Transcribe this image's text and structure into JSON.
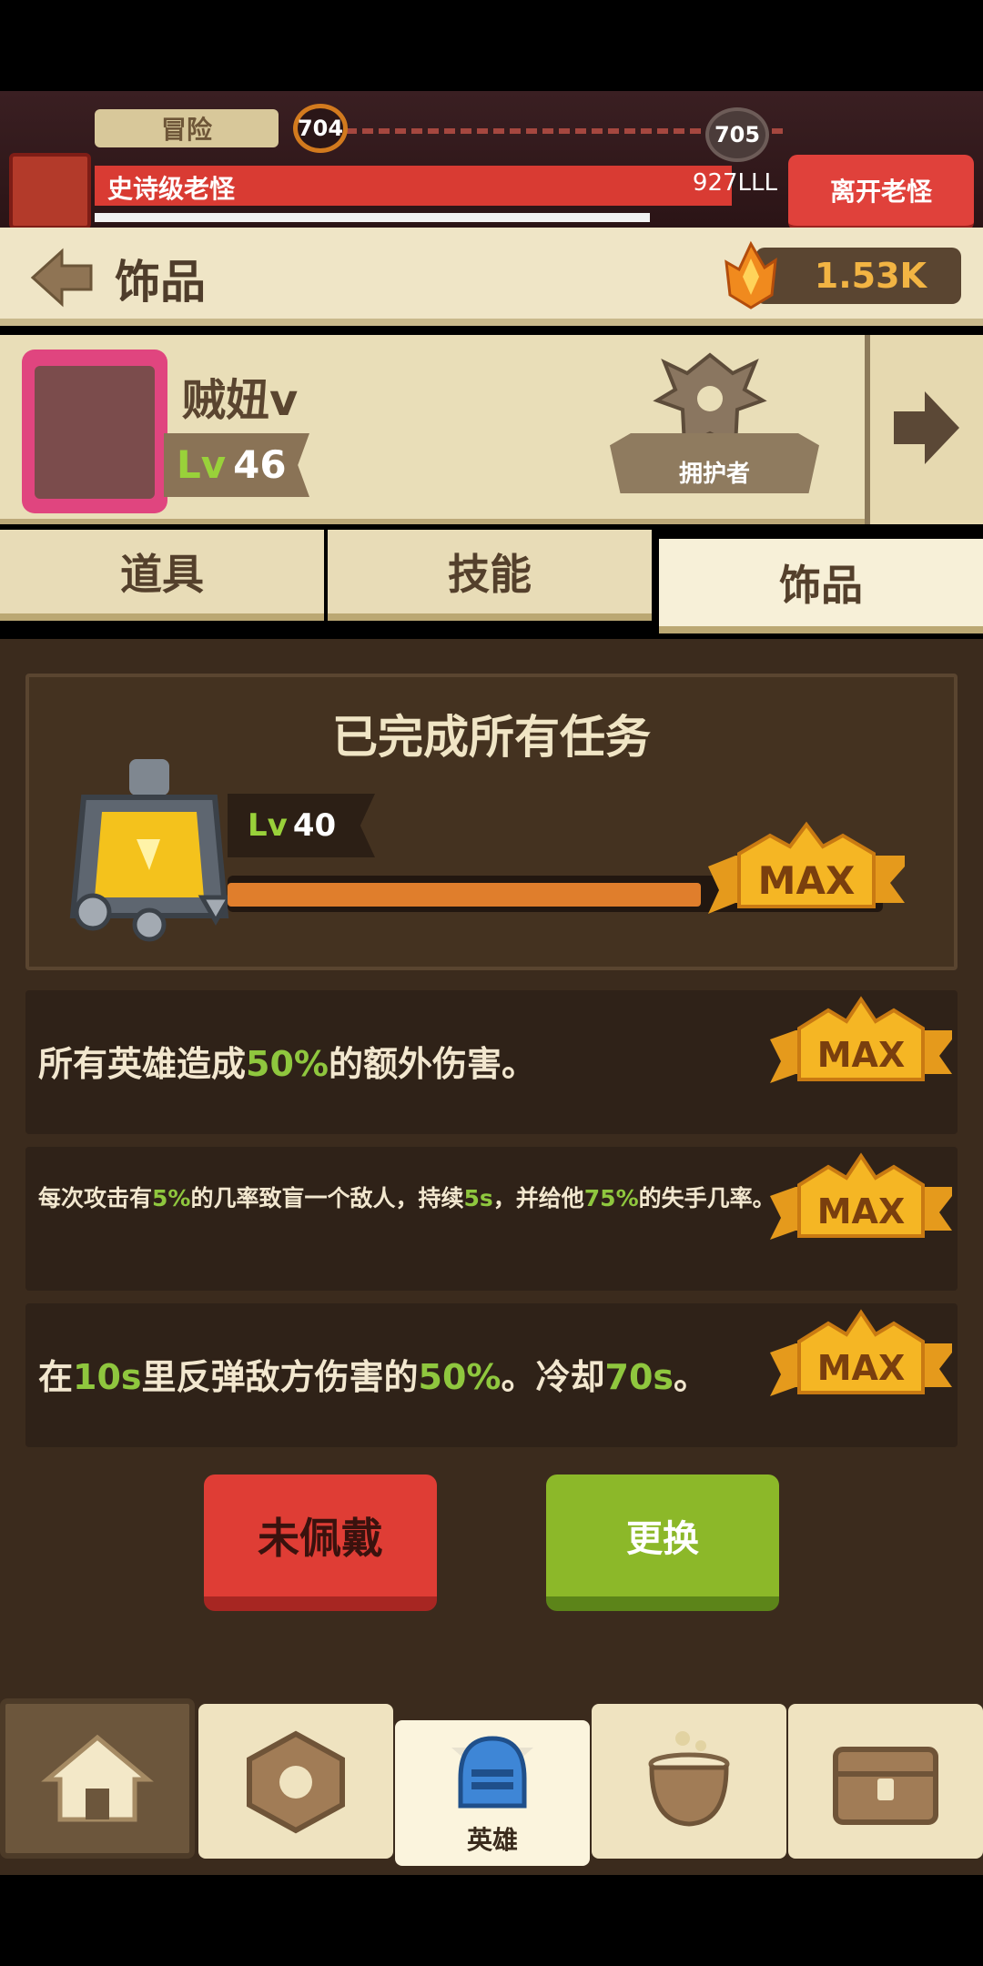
{
  "top": {
    "mode_label": "冒险",
    "stage_current": "704",
    "stage_next": "705",
    "boss_name": "史诗级老怪",
    "boss_hp": "927LLL",
    "leave_button": "离开老怪"
  },
  "header": {
    "title": "饰品",
    "currency_amount": "1.53K"
  },
  "hero": {
    "name": "贼妞v",
    "level_prefix": "Lv",
    "level": "46",
    "role": "拥护者"
  },
  "tabs": [
    {
      "label": "道具"
    },
    {
      "label": "技能"
    },
    {
      "label": "饰品"
    }
  ],
  "quest": {
    "title": "已完成所有任务",
    "level_prefix": "Lv",
    "level": "40",
    "max_label": "MAX",
    "progress": 1.0
  },
  "effects": [
    {
      "parts": [
        "所有英雄造成",
        "50%",
        "的额外伤害。"
      ],
      "max_label": "MAX"
    },
    {
      "parts": [
        "每次攻击有",
        "5%",
        "的几率致盲一个敌人，持续",
        "5s",
        "，并给他",
        "75%",
        "的失手几率。"
      ],
      "max_label": "MAX"
    },
    {
      "parts": [
        "在",
        "10s",
        "里反弹敌方伤害的",
        "50%",
        "。冷却",
        "70s",
        "。"
      ],
      "max_label": "MAX"
    }
  ],
  "buttons": {
    "unequip": "未佩戴",
    "replace": "更换"
  },
  "nav": {
    "items": [
      {
        "icon": "home-icon",
        "label": ""
      },
      {
        "icon": "hex-nut-icon",
        "label": ""
      },
      {
        "icon": "helmet-icon",
        "label": "英雄"
      },
      {
        "icon": "cauldron-icon",
        "label": ""
      },
      {
        "icon": "chest-icon",
        "label": ""
      }
    ]
  },
  "colors": {
    "accent_red": "#df3d35",
    "accent_green": "#8cb829",
    "highlight_green": "#8fc73e",
    "gold": "#f2b443"
  }
}
